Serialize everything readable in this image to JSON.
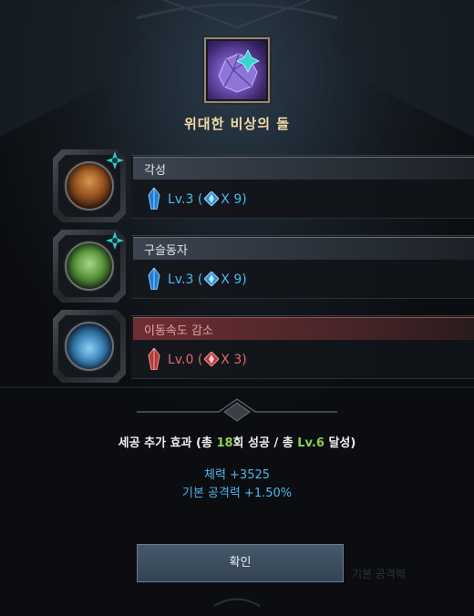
{
  "item": {
    "name": "위대한 비상의 돌",
    "icon": "purple-stone-icon"
  },
  "rows": [
    {
      "name": "각성",
      "level_text": "Lv.3",
      "multiplier": "X 9",
      "color": "#4fb7ef",
      "header_color": "#3b4450",
      "portrait_icon": "awakening-portrait-icon",
      "marked": true
    },
    {
      "name": "구슬동자",
      "level_text": "Lv.3",
      "multiplier": "X 9",
      "color": "#4fb7ef",
      "header_color": "#3b4450",
      "portrait_icon": "orb-figure-portrait-icon",
      "marked": true
    },
    {
      "name": "이동속도 감소",
      "level_text": "Lv.0",
      "multiplier": "X 3",
      "color": "#e06b6b",
      "header_color": "#6e2f33",
      "portrait_icon": "slow-boot-portrait-icon",
      "marked": false
    }
  ],
  "bonus": {
    "prefix": "세공 추가 효과 (총 ",
    "success_count": "18",
    "middle": "회 성공 / 총 ",
    "level": "Lv.6",
    "suffix": " 달성)",
    "highlight_color": "#8fd14f",
    "stats": [
      "체력 +3525",
      "기본 공격력 +1.50%"
    ]
  },
  "confirm_label": "확인",
  "background_text": "기본 공격력"
}
